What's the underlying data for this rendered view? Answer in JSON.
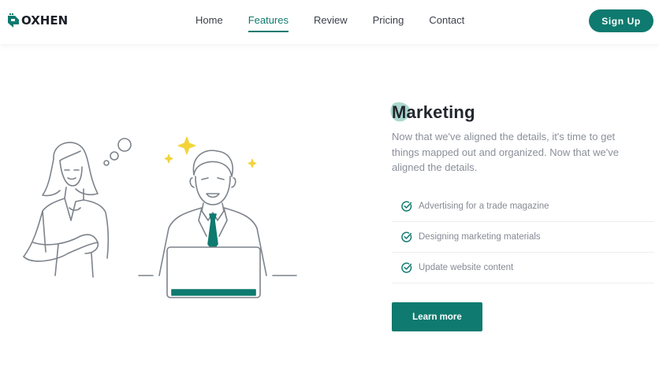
{
  "brand": {
    "name": "OXHEN",
    "accent": "#0f7a6f"
  },
  "nav": {
    "items": [
      {
        "label": "Home",
        "active": false
      },
      {
        "label": "Features",
        "active": true
      },
      {
        "label": "Review",
        "active": false
      },
      {
        "label": "Pricing",
        "active": false
      },
      {
        "label": "Contact",
        "active": false
      }
    ],
    "signup_label": "Sign Up"
  },
  "hero": {
    "illustration": "two-people-at-laptop-illustration",
    "title": "Marketing",
    "description": "Now that we've aligned the details, it's time to get things mapped out and organized. Now that we've aligned the details.",
    "features": [
      {
        "label": "Advertising for a trade magazine",
        "icon": "check-circle-icon"
      },
      {
        "label": "Designing marketing materials",
        "icon": "check-circle-icon"
      },
      {
        "label": "Update website content",
        "icon": "check-circle-icon"
      }
    ],
    "cta_label": "Learn more"
  }
}
